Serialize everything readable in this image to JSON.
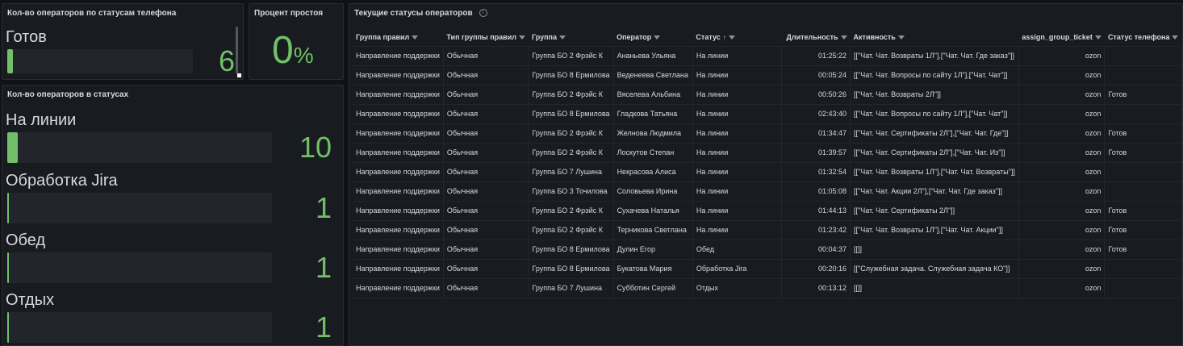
{
  "phone_status_panel": {
    "title": "Кол-во операторов по статусам телефона",
    "items": [
      {
        "label": "Готов",
        "value": "6",
        "fill": 0.03
      }
    ]
  },
  "idle_panel": {
    "title": "Процент простоя",
    "value": "0",
    "unit": "%"
  },
  "status_count_panel": {
    "title": "Кол-во операторов в статусах",
    "items": [
      {
        "label": "На линии",
        "value": "10",
        "fill": 0.04
      },
      {
        "label": "Обработка Jira",
        "value": "1",
        "fill": 0.004
      },
      {
        "label": "Обед",
        "value": "1",
        "fill": 0.004
      },
      {
        "label": "Отдых",
        "value": "1",
        "fill": 0.004
      }
    ]
  },
  "operators_table": {
    "title": "Текущие статусы операторов",
    "columns": [
      "Группа правил",
      "Тип группы правил",
      "Группа",
      "Оператор",
      "Статус",
      "Длительность",
      "Активность",
      "assign_group_ticket",
      "Статус телефона"
    ],
    "rows": [
      [
        "Направление поддержки",
        "Обычная",
        "Группа БО 2 Фрэйс К",
        "Ананьева Ульяна",
        "На линии",
        "01:25:22",
        "[[\"Чат. Чат. Возвраты 1Л\"],[\"Чат. Чат. Где заказ\"]]",
        "ozon",
        ""
      ],
      [
        "Направление поддержки",
        "Обычная",
        "Группа БО 8 Ермилова",
        "Веденеева Светлана",
        "На линии",
        "00:05:24",
        "[[\"Чат. Чат. Вопросы по сайту 1Л\"],[\"Чат. Чат\"]]",
        "ozon",
        ""
      ],
      [
        "Направление поддержки",
        "Обычная",
        "Группа БО 2 Фрэйс К",
        "Вяселева Альбина",
        "На линии",
        "00:50:26",
        "[[\"Чат. Чат. Возвраты 2Л\"]]",
        "ozon",
        "Готов"
      ],
      [
        "Направление поддержки",
        "Обычная",
        "Группа БО 8 Ермилова",
        "Гладкова Татьяна",
        "На линии",
        "02:43:40",
        "[[\"Чат. Чат. Вопросы по сайту 1Л\"],[\"Чат. Чат\"]]",
        "ozon",
        ""
      ],
      [
        "Направление поддержки",
        "Обычная",
        "Группа БО 2 Фрэйс К",
        "Желнова Людмила",
        "На линии",
        "01:34:47",
        "[[\"Чат. Чат. Сертификаты 2Л\"],[\"Чат. Чат. Где\"]]",
        "ozon",
        "Готов"
      ],
      [
        "Направление поддержки",
        "Обычная",
        "Группа БО 2 Фрэйс К",
        "Лоскутов Степан",
        "На линии",
        "01:39:57",
        "[[\"Чат. Чат. Сертификаты 2Л\"],[\"Чат. Чат. Из\"]]",
        "ozon",
        "Готов"
      ],
      [
        "Направление поддержки",
        "Обычная",
        "Группа БО 7 Лушина",
        "Некрасова Алиса",
        "На линии",
        "01:32:54",
        "[[\"Чат. Чат. Возвраты 1Л\"],[\"Чат. Чат. Возвраты\"]]",
        "ozon",
        ""
      ],
      [
        "Направление поддержки",
        "Обычная",
        "Группа БО 3 Точилова",
        "Соловьева Ирина",
        "На линии",
        "01:05:08",
        "[[\"Чат. Чат. Акции 2Л\"],[\"Чат. Чат. Где заказ\"]]",
        "ozon",
        ""
      ],
      [
        "Направление поддержки",
        "Обычная",
        "Группа БО 2 Фрэйс К",
        "Сухачева Наталья",
        "На линии",
        "01:44:13",
        "[[\"Чат. Чат. Сертификаты 2Л\"]]",
        "ozon",
        "Готов"
      ],
      [
        "Направление поддержки",
        "Обычная",
        "Группа БО 2 Фрэйс К",
        "Терникова Светлана",
        "На линии",
        "01:23:42",
        "[[\"Чат. Чат. Возвраты 1Л\"],[\"Чат. Чат. Акции\"]]",
        "ozon",
        "Готов"
      ],
      [
        "Направление поддержки",
        "Обычная",
        "Группа БО 8 Ермилова",
        "Дулин Егор",
        "Обед",
        "00:04:37",
        "[[]]",
        "ozon",
        "Готов"
      ],
      [
        "Направление поддержки",
        "Обычная",
        "Группа БО 8 Ермилова",
        "Букатова Мария",
        "Обработка Jira",
        "00:20:16",
        "[[\"Служебная задача. Служебная задача КО\"]]",
        "ozon",
        ""
      ],
      [
        "Направление поддержки",
        "Обычная",
        "Группа БО 7 Лушина",
        "Субботин Сергей",
        "Отдых",
        "00:13:12",
        "[[]]",
        "ozon",
        ""
      ]
    ]
  }
}
